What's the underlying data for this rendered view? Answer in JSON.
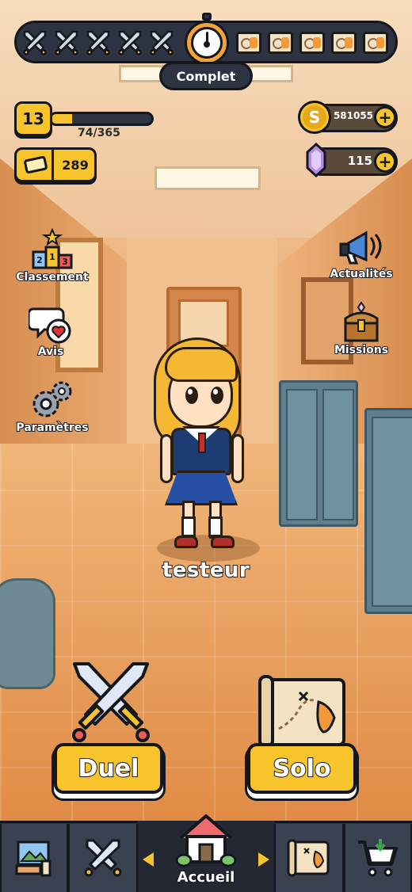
{
  "top_bar": {
    "status_label": "Complet",
    "duel_slots": 5,
    "solo_slots": 5
  },
  "player": {
    "level": "13",
    "xp_text": "74/365",
    "xp_fraction": 0.203,
    "tickets": "289",
    "name": "testeur"
  },
  "currency": {
    "coins": "581055",
    "gems": "115",
    "coin_symbol": "S"
  },
  "side_menu": {
    "left": [
      {
        "label": "Classement",
        "icon": "podium-icon"
      },
      {
        "label": "Avis",
        "icon": "chat-heart-icon"
      },
      {
        "label": "Paramètres",
        "icon": "gears-icon"
      }
    ],
    "right": [
      {
        "label": "Actualités",
        "icon": "megaphone-icon"
      },
      {
        "label": "Missions",
        "icon": "treasure-chest-icon"
      }
    ]
  },
  "modes": {
    "duel_label": "Duel",
    "solo_label": "Solo"
  },
  "bottom_nav": {
    "home_label": "Accueil",
    "items": [
      "gallery-icon",
      "swords-icon",
      "house-icon",
      "map-icon",
      "cart-icon"
    ]
  },
  "colors": {
    "accent": "#f7c52b",
    "panel": "#2d3340",
    "outline": "#14171d"
  }
}
